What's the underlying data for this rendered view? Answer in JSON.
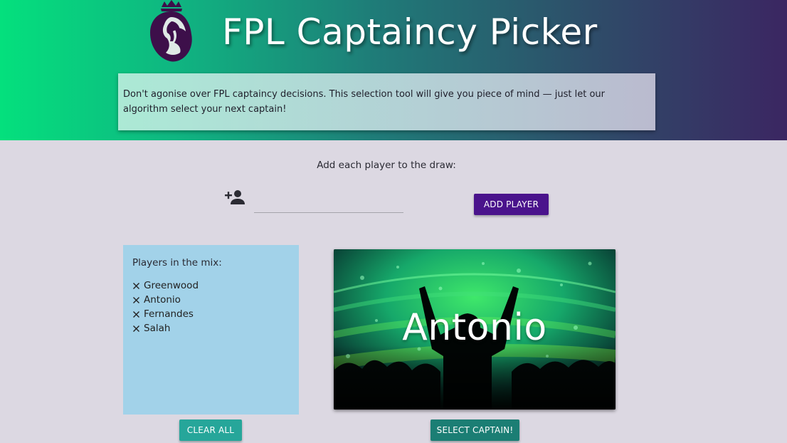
{
  "header": {
    "title": "FPL Captaincy Picker",
    "intro": "Don't agonise over FPL captaincy decisions. This selection tool will give you piece of mind — just let our algorithm select your next captain!"
  },
  "add_section": {
    "label": "Add each player to the draw:",
    "input_value": "",
    "input_placeholder": "",
    "add_button": "ADD PLAYER"
  },
  "players": {
    "heading": "Players in the mix:",
    "items": [
      {
        "name": "Greenwood"
      },
      {
        "name": "Antonio"
      },
      {
        "name": "Fernandes"
      },
      {
        "name": "Salah"
      }
    ],
    "clear_button": "CLEAR ALL"
  },
  "captain": {
    "selected_name": "Antonio",
    "select_button": "SELECT CAPTAIN!"
  },
  "icons": {
    "logo": "premier-league-lion-icon",
    "add_user": "person-add-icon",
    "remove": "close-icon"
  },
  "colors": {
    "header_gradient_start": "#04e07d",
    "header_gradient_end": "#3b2662",
    "add_button": "#4a138c",
    "clear_button": "#26a69a",
    "select_button": "#1b7e74",
    "players_card": "#a2d2e9",
    "page_background": "#dcd8e2"
  }
}
